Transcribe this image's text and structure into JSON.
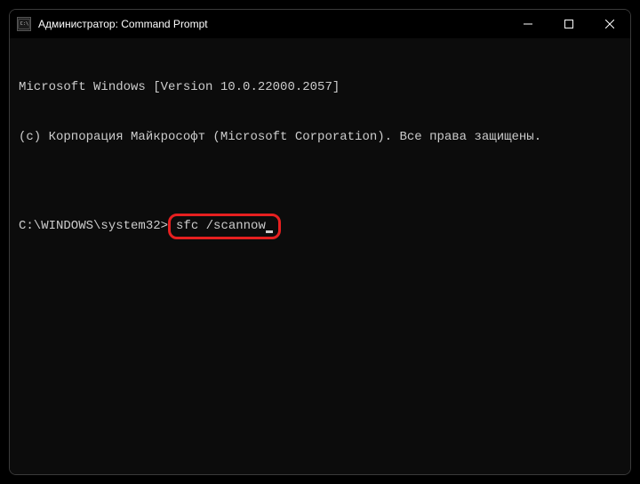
{
  "titlebar": {
    "icon_label": "cmd-icon",
    "title": "Администратор: Command Prompt"
  },
  "terminal": {
    "line1": "Microsoft Windows [Version 10.0.22000.2057]",
    "line2": "(c) Корпорация Майкрософт (Microsoft Corporation). Все права защищены.",
    "blank": "",
    "prompt": "C:\\WINDOWS\\system32>",
    "command": "sfc /scannow"
  }
}
